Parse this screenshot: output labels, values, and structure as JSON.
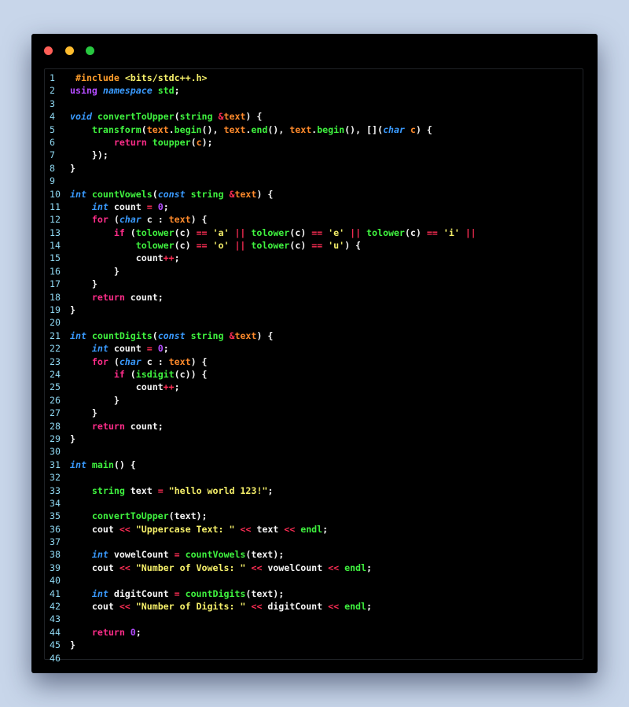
{
  "window": {
    "controls": [
      {
        "name": "close-button",
        "color": "#ff5f57"
      },
      {
        "name": "minimize-button",
        "color": "#febc2e"
      },
      {
        "name": "maximize-button",
        "color": "#28c840"
      }
    ]
  },
  "colors": {
    "default": "#f5f5f5",
    "preprocessor": "#ff9e2c",
    "keyword": "#b44cff",
    "type": "#3a9bff",
    "function": "#3ff23f",
    "control": "#ff2d8a",
    "identifier": "#ff8a2b",
    "operator": "#ff2d55",
    "number": "#b44cff",
    "string": "#f6f06a",
    "line_number": "#8fd8f2"
  },
  "code": {
    "lines": [
      [
        [
          "preprocessor",
          " #include "
        ],
        [
          "string",
          "<bits/stdc++.h>"
        ]
      ],
      [
        [
          "keyword",
          "using "
        ],
        [
          "type",
          "namespace "
        ],
        [
          "function",
          "std"
        ],
        [
          "default",
          ";"
        ]
      ],
      [],
      [
        [
          "type",
          "void "
        ],
        [
          "function",
          "convertToUpper"
        ],
        [
          "default",
          "("
        ],
        [
          "function",
          "string "
        ],
        [
          "operator",
          "&"
        ],
        [
          "identifier",
          "text"
        ],
        [
          "default",
          ") {"
        ]
      ],
      [
        [
          "default",
          "    "
        ],
        [
          "function",
          "transform"
        ],
        [
          "default",
          "("
        ],
        [
          "identifier",
          "text"
        ],
        [
          "default",
          "."
        ],
        [
          "function",
          "begin"
        ],
        [
          "default",
          "(), "
        ],
        [
          "identifier",
          "text"
        ],
        [
          "default",
          "."
        ],
        [
          "function",
          "end"
        ],
        [
          "default",
          "(), "
        ],
        [
          "identifier",
          "text"
        ],
        [
          "default",
          "."
        ],
        [
          "function",
          "begin"
        ],
        [
          "default",
          "(), []("
        ],
        [
          "type",
          "char "
        ],
        [
          "identifier",
          "c"
        ],
        [
          "default",
          ") {"
        ]
      ],
      [
        [
          "default",
          "        "
        ],
        [
          "control",
          "return "
        ],
        [
          "function",
          "toupper"
        ],
        [
          "default",
          "("
        ],
        [
          "identifier",
          "c"
        ],
        [
          "default",
          ");"
        ]
      ],
      [
        [
          "default",
          "    });"
        ]
      ],
      [
        [
          "default",
          "}"
        ]
      ],
      [],
      [
        [
          "type",
          "int "
        ],
        [
          "function",
          "countVowels"
        ],
        [
          "default",
          "("
        ],
        [
          "type",
          "const "
        ],
        [
          "function",
          "string "
        ],
        [
          "operator",
          "&"
        ],
        [
          "identifier",
          "text"
        ],
        [
          "default",
          ") {"
        ]
      ],
      [
        [
          "default",
          "    "
        ],
        [
          "type",
          "int "
        ],
        [
          "default",
          "count "
        ],
        [
          "operator",
          "= "
        ],
        [
          "number",
          "0"
        ],
        [
          "default",
          ";"
        ]
      ],
      [
        [
          "default",
          "    "
        ],
        [
          "control",
          "for "
        ],
        [
          "default",
          "("
        ],
        [
          "type",
          "char "
        ],
        [
          "default",
          "c : "
        ],
        [
          "identifier",
          "text"
        ],
        [
          "default",
          ") {"
        ]
      ],
      [
        [
          "default",
          "        "
        ],
        [
          "control",
          "if "
        ],
        [
          "default",
          "("
        ],
        [
          "function",
          "tolower"
        ],
        [
          "default",
          "(c) "
        ],
        [
          "operator",
          "== "
        ],
        [
          "string",
          "'a' "
        ],
        [
          "operator",
          "|| "
        ],
        [
          "function",
          "tolower"
        ],
        [
          "default",
          "(c) "
        ],
        [
          "operator",
          "== "
        ],
        [
          "string",
          "'e' "
        ],
        [
          "operator",
          "|| "
        ],
        [
          "function",
          "tolower"
        ],
        [
          "default",
          "(c) "
        ],
        [
          "operator",
          "== "
        ],
        [
          "string",
          "'i' "
        ],
        [
          "operator",
          "||"
        ]
      ],
      [
        [
          "default",
          "            "
        ],
        [
          "function",
          "tolower"
        ],
        [
          "default",
          "(c) "
        ],
        [
          "operator",
          "== "
        ],
        [
          "string",
          "'o' "
        ],
        [
          "operator",
          "|| "
        ],
        [
          "function",
          "tolower"
        ],
        [
          "default",
          "(c) "
        ],
        [
          "operator",
          "== "
        ],
        [
          "string",
          "'u'"
        ],
        [
          "default",
          ") {"
        ]
      ],
      [
        [
          "default",
          "            count"
        ],
        [
          "operator",
          "++"
        ],
        [
          "default",
          ";"
        ]
      ],
      [
        [
          "default",
          "        }"
        ]
      ],
      [
        [
          "default",
          "    }"
        ]
      ],
      [
        [
          "default",
          "    "
        ],
        [
          "control",
          "return "
        ],
        [
          "default",
          "count;"
        ]
      ],
      [
        [
          "default",
          "}"
        ]
      ],
      [],
      [
        [
          "type",
          "int "
        ],
        [
          "function",
          "countDigits"
        ],
        [
          "default",
          "("
        ],
        [
          "type",
          "const "
        ],
        [
          "function",
          "string "
        ],
        [
          "operator",
          "&"
        ],
        [
          "identifier",
          "text"
        ],
        [
          "default",
          ") {"
        ]
      ],
      [
        [
          "default",
          "    "
        ],
        [
          "type",
          "int "
        ],
        [
          "default",
          "count "
        ],
        [
          "operator",
          "= "
        ],
        [
          "number",
          "0"
        ],
        [
          "default",
          ";"
        ]
      ],
      [
        [
          "default",
          "    "
        ],
        [
          "control",
          "for "
        ],
        [
          "default",
          "("
        ],
        [
          "type",
          "char "
        ],
        [
          "default",
          "c : "
        ],
        [
          "identifier",
          "text"
        ],
        [
          "default",
          ") {"
        ]
      ],
      [
        [
          "default",
          "        "
        ],
        [
          "control",
          "if "
        ],
        [
          "default",
          "("
        ],
        [
          "function",
          "isdigit"
        ],
        [
          "default",
          "(c)) {"
        ]
      ],
      [
        [
          "default",
          "            count"
        ],
        [
          "operator",
          "++"
        ],
        [
          "default",
          ";"
        ]
      ],
      [
        [
          "default",
          "        }"
        ]
      ],
      [
        [
          "default",
          "    }"
        ]
      ],
      [
        [
          "default",
          "    "
        ],
        [
          "control",
          "return "
        ],
        [
          "default",
          "count;"
        ]
      ],
      [
        [
          "default",
          "}"
        ]
      ],
      [],
      [
        [
          "type",
          "int "
        ],
        [
          "function",
          "main"
        ],
        [
          "default",
          "() {"
        ]
      ],
      [],
      [
        [
          "default",
          "    "
        ],
        [
          "function",
          "string "
        ],
        [
          "default",
          "text "
        ],
        [
          "operator",
          "= "
        ],
        [
          "string",
          "\"hello world 123!\""
        ],
        [
          "default",
          ";"
        ]
      ],
      [],
      [
        [
          "default",
          "    "
        ],
        [
          "function",
          "convertToUpper"
        ],
        [
          "default",
          "(text);"
        ]
      ],
      [
        [
          "default",
          "    cout "
        ],
        [
          "operator",
          "<< "
        ],
        [
          "string",
          "\"Uppercase Text: \" "
        ],
        [
          "operator",
          "<< "
        ],
        [
          "default",
          "text "
        ],
        [
          "operator",
          "<< "
        ],
        [
          "function",
          "endl"
        ],
        [
          "default",
          ";"
        ]
      ],
      [],
      [
        [
          "default",
          "    "
        ],
        [
          "type",
          "int "
        ],
        [
          "default",
          "vowelCount "
        ],
        [
          "operator",
          "= "
        ],
        [
          "function",
          "countVowels"
        ],
        [
          "default",
          "(text);"
        ]
      ],
      [
        [
          "default",
          "    cout "
        ],
        [
          "operator",
          "<< "
        ],
        [
          "string",
          "\"Number of Vowels: \" "
        ],
        [
          "operator",
          "<< "
        ],
        [
          "default",
          "vowelCount "
        ],
        [
          "operator",
          "<< "
        ],
        [
          "function",
          "endl"
        ],
        [
          "default",
          ";"
        ]
      ],
      [],
      [
        [
          "default",
          "    "
        ],
        [
          "type",
          "int "
        ],
        [
          "default",
          "digitCount "
        ],
        [
          "operator",
          "= "
        ],
        [
          "function",
          "countDigits"
        ],
        [
          "default",
          "(text);"
        ]
      ],
      [
        [
          "default",
          "    cout "
        ],
        [
          "operator",
          "<< "
        ],
        [
          "string",
          "\"Number of Digits: \" "
        ],
        [
          "operator",
          "<< "
        ],
        [
          "default",
          "digitCount "
        ],
        [
          "operator",
          "<< "
        ],
        [
          "function",
          "endl"
        ],
        [
          "default",
          ";"
        ]
      ],
      [],
      [
        [
          "default",
          "    "
        ],
        [
          "control",
          "return "
        ],
        [
          "number",
          "0"
        ],
        [
          "default",
          ";"
        ]
      ],
      [
        [
          "default",
          "}"
        ]
      ],
      []
    ]
  }
}
